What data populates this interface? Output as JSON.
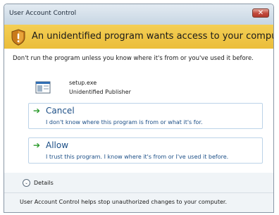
{
  "window": {
    "title": "User Account Control",
    "close_label": "✕"
  },
  "banner": {
    "text": "An unidentified program wants access to your computer",
    "icon": "shield-icon"
  },
  "intro": {
    "text": "Don't run the program unless you know where it's from or you've used it before."
  },
  "program": {
    "name": "setup.exe",
    "publisher": "Unidentified Publisher",
    "icon": "program-icon"
  },
  "options": {
    "cancel": {
      "title": "Cancel",
      "description": "I don't know where this program is from or what it's for."
    },
    "allow": {
      "title": "Allow",
      "description": "I trust this program. I know where it's from or I've used it before."
    },
    "arrow_glyph": "➔"
  },
  "details": {
    "label": "Details",
    "glyph": "⌄"
  },
  "footer": {
    "text": "User Account Control helps stop unauthorized changes to your computer."
  },
  "colors": {
    "banner": "#f0c84a",
    "link": "#1b4e86",
    "arrow": "#2a9a2a"
  }
}
